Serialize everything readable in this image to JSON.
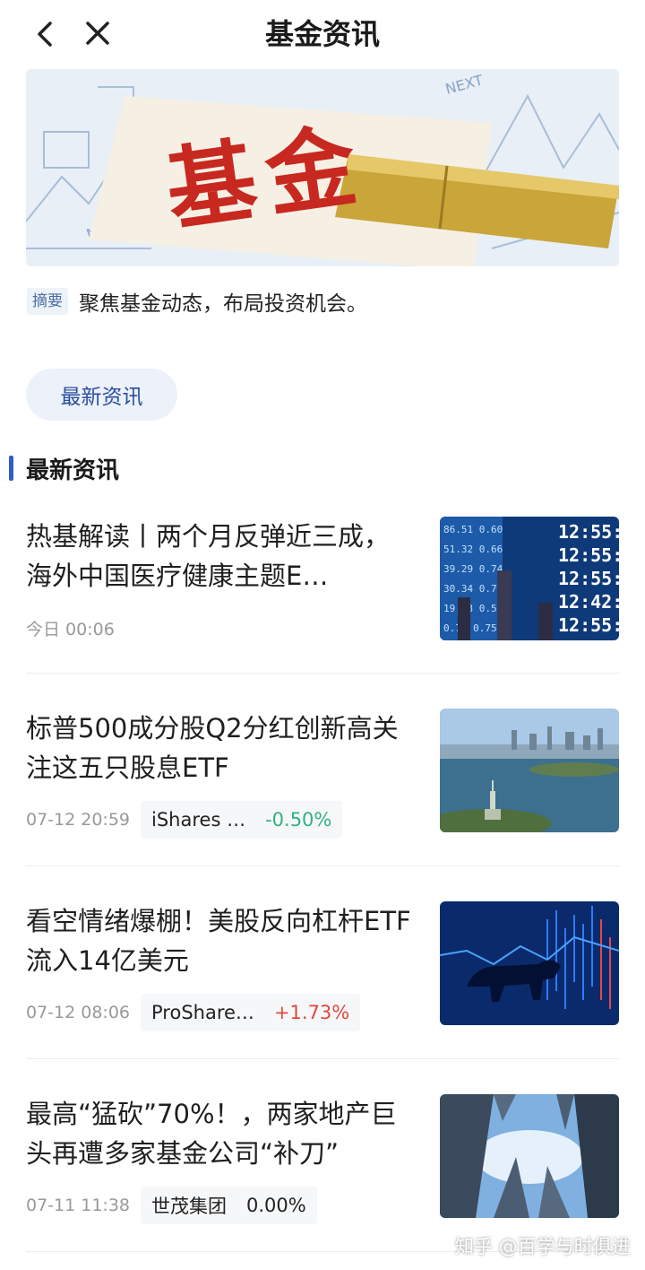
{
  "header": {
    "title": "基金资讯",
    "back_icon": "chevron-left-icon",
    "close_icon": "close-icon"
  },
  "banner": {
    "text": "基金"
  },
  "summary": {
    "tag": "摘要",
    "text": "聚焦基金动态，布局投资机会。"
  },
  "filter_pill": {
    "label": "最新资讯"
  },
  "section": {
    "title": "最新资讯"
  },
  "news": [
    {
      "title": "热基解读丨两个月反弹近三成，海外中国医疗健康主题E…",
      "time": "今日 00:06",
      "fund": "",
      "change": ""
    },
    {
      "title": "标普500成分股Q2分红创新高关注这五只股息ETF",
      "time": "07-12 20:59",
      "fund": "iShares …",
      "change": "-0.50%"
    },
    {
      "title": "看空情绪爆棚！美股反向杠杆ETF流入14亿美元",
      "time": "07-12 08:06",
      "fund": "ProShare…",
      "change": "+1.73%"
    },
    {
      "title": "最高“猛砍”70%！，两家地产巨头再遭多家基金公司“补刀”",
      "time": "07-11 11:38",
      "fund": "世茂集团",
      "change": "0.00%"
    }
  ],
  "watermark": "知乎 @百学与时俱进",
  "colors": {
    "accent": "#2f5ec4",
    "negative": "#2fb37f",
    "positive": "#e04a3a",
    "banner_red": "#c7281f"
  }
}
